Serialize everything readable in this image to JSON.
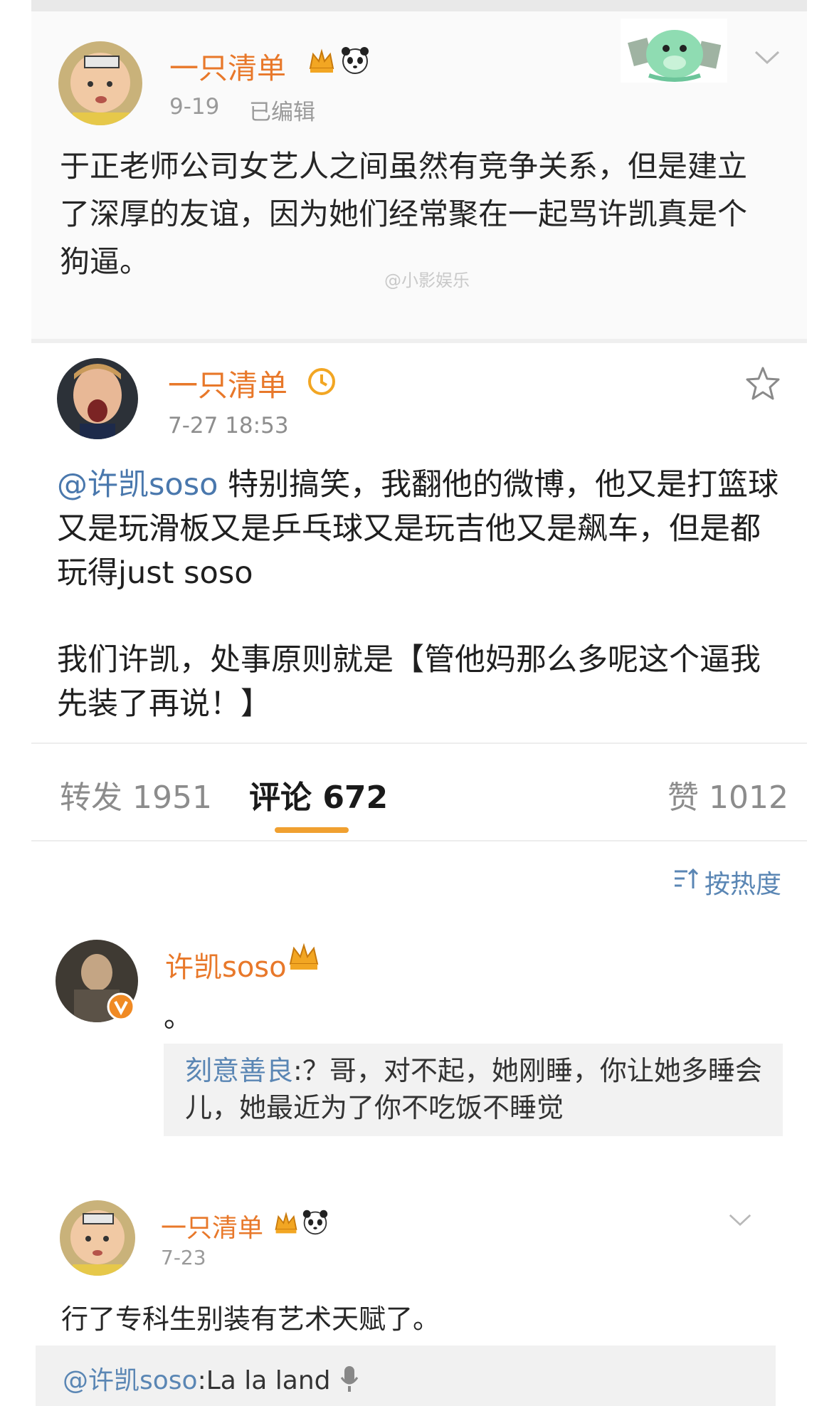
{
  "post1": {
    "username": "一只清单",
    "time": "9-19",
    "edited": "已编辑",
    "content": "于正老师公司女艺人之间虽然有竞争关系，但是建立了深厚的友谊，因为她们经常聚在一起骂许凯真是个狗逼。",
    "watermark": "@小影娱乐"
  },
  "post2": {
    "username": "一只清单",
    "time": "7-27 18:53",
    "mention": "@许凯soso",
    "content_p1": " 特别搞笑，我翻他的微博，他又是打篮球又是玩滑板又是乒乓球又是玩吉他又是飙车，但是都玩得just soso",
    "content_p2": "我们许凯，处事原则就是【管他妈那么多呢这个逼我先装了再说！】"
  },
  "tabs": {
    "repost": "转发 1951",
    "comment": "评论 672",
    "like": "赞 1012"
  },
  "sort": {
    "label": "按热度"
  },
  "comment1": {
    "username": "许凯soso",
    "content": "。",
    "reply_name": "刻意善良",
    "reply_text": ":？哥，对不起，她刚睡，你让她多睡会儿，她最近为了你不吃饭不睡觉"
  },
  "post3": {
    "username": "一只清单",
    "time": "7-23",
    "content": "行了专科生别装有艺术天赋了。",
    "reply_mention": "@许凯soso",
    "reply_text": ":La la land"
  },
  "colors": {
    "username": "#e8782a",
    "link": "#4a78ad",
    "tab_indicator": "#f0a030"
  }
}
